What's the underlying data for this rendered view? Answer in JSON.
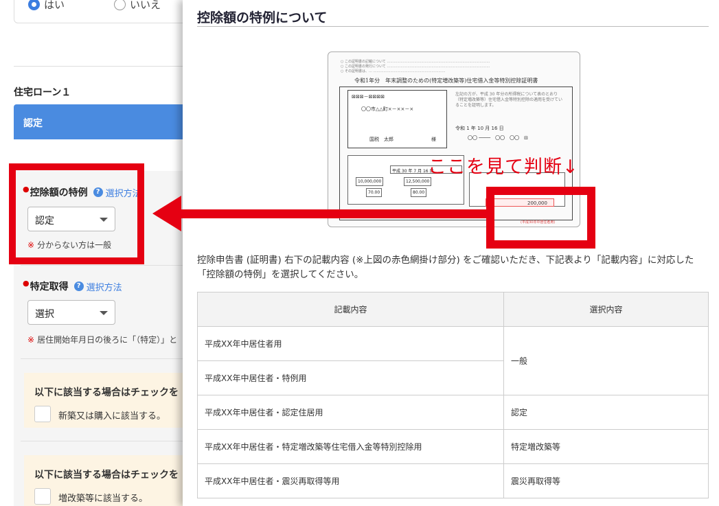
{
  "form": {
    "radio_yes": "はい",
    "radio_no": "いいえ",
    "loan_title": "住宅ローン１",
    "loan_header": "認定",
    "deduction_label": "控除額の特例",
    "help_link": "選択方法",
    "deduction_value": "認定",
    "deduction_note": "分からない方は一般",
    "note_mark": "※",
    "specific_label": "特定取得",
    "specific_value": "選択",
    "specific_note": "居住開始年月日の後ろに「（特定）」と",
    "check1_title": "以下に該当する場合はチェックを",
    "check1_label": "新築又は購入に該当する。",
    "check2_title": "以下に該当する場合はチェックを",
    "check2_label": "増改築等に該当する。"
  },
  "modal": {
    "title": "控除額の特例について",
    "callout": "ここを見て判断↓",
    "description": "控除申告書 (証明書) 右下の記載内容 (※上図の赤色網掛け部分) をご確認いただき、下記表より「記載内容」に対応した「控除額の特例」を選択してください。",
    "document": {
      "title": "令和1年分　年末調整のための(特定増改築等)住宅借入金等特別控除証明書",
      "address": "〇〇市△△町×－××－×",
      "name": "国税　太郎",
      "honorific": "様",
      "text": "左記の方が、平成 30 年分の所得税について表のとおり（特定増改築等）住宅借入金等特別控除の適用を受けていることを証明します。",
      "date": "令和 1 年 10 月 16 日",
      "year_cell": "平成 30 年 7 月 16 日",
      "amount1": "10,000,000",
      "amount2": "12,500,000",
      "amount3": "70.00",
      "amount4": "80.00",
      "amount5": "200,000",
      "stamp_note": "(平成30年中居住者用)"
    },
    "table": {
      "headers": [
        "記載内容",
        "選択内容"
      ],
      "rows": [
        {
          "content": "平成XX年中居住者用",
          "choice": "一般"
        },
        {
          "content": "平成XX年中居住者・特例用",
          "choice": ""
        },
        {
          "content": "平成XX年中居住者・認定住居用",
          "choice": "認定"
        },
        {
          "content": "平成XX年中居住者・特定増改築等住宅借入金等特別控除用",
          "choice": "特定増改築等"
        },
        {
          "content": "平成XX年中居住者・震災再取得等用",
          "choice": "震災再取得等"
        }
      ]
    }
  },
  "colors": {
    "accent": "#4a8be0",
    "highlight_red": "#e50012",
    "check_panel": "#fdf4e3"
  }
}
